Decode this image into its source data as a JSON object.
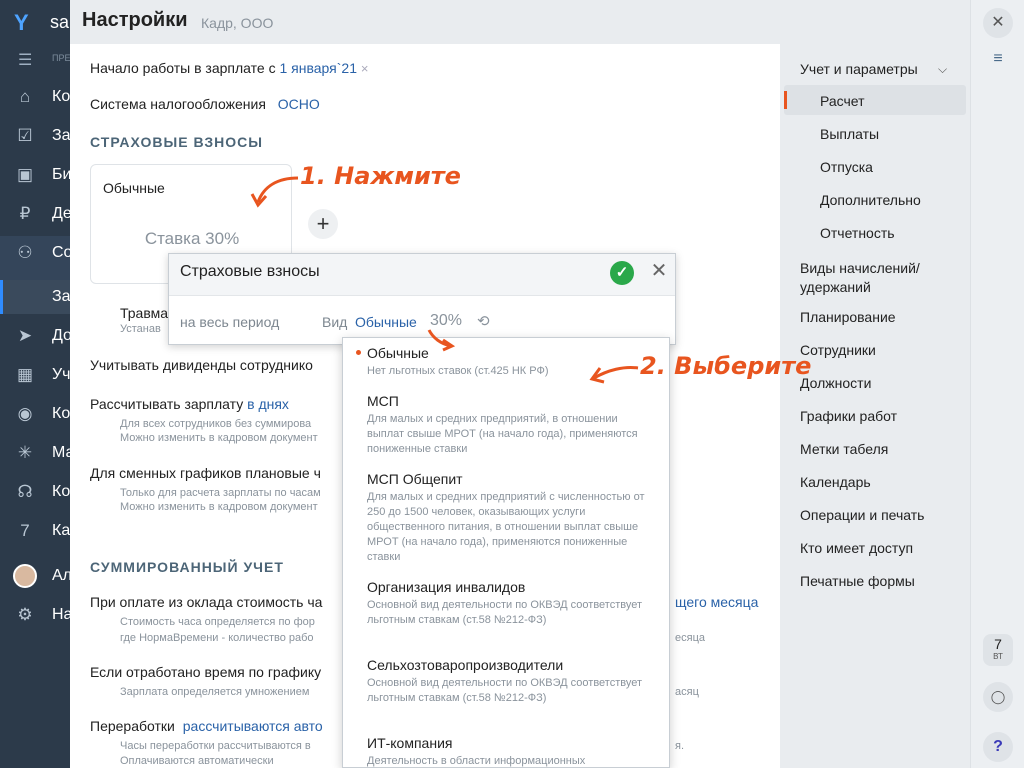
{
  "app": {
    "brand": "sa",
    "nav_hint": "ПРЕ"
  },
  "leftnav": {
    "items": [
      {
        "label": "Ко",
        "icon": "home-icon"
      },
      {
        "label": "За",
        "icon": "tasks-icon"
      },
      {
        "label": "Би",
        "icon": "briefcase-icon"
      },
      {
        "label": "Де",
        "icon": "money-icon"
      },
      {
        "label": "Со",
        "icon": "people-icon"
      },
      {
        "label": "За",
        "icon": "submenu-icon"
      },
      {
        "label": "До",
        "icon": "send-icon"
      },
      {
        "label": "Уч",
        "icon": "calculator-icon"
      },
      {
        "label": "Ко",
        "icon": "location-icon"
      },
      {
        "label": "Ма",
        "icon": "burst-icon"
      },
      {
        "label": "Ко",
        "icon": "headset-icon"
      },
      {
        "label": "Ка",
        "icon": "calendar-icon"
      },
      {
        "label": "Ал",
        "icon": "avatar"
      },
      {
        "label": "На",
        "icon": "gear-icon"
      }
    ]
  },
  "header": {
    "title": "Настройки",
    "subtitle": "Кадр, ООО"
  },
  "main": {
    "start_label": "Начало работы в зарплате с",
    "start_value": "1 января`21",
    "tax_label": "Система налогообложения",
    "tax_value": "ОСНО",
    "insurance_section": "СТРАХОВЫЕ ВЗНОСЫ",
    "card_title": "Обычные",
    "card_rate": "Ставка 30%",
    "plus": "+",
    "injury_label": "Травма",
    "injury_hint": "Устанав",
    "dividends_label": "Учитывать дивиденды сотруднико",
    "salary_label": "Рассчитывать зарплату",
    "salary_value": "в днях",
    "salary_hint1": "Для всех сотрудников без суммирова",
    "salary_hint2": "Можно изменить в кадровом документ",
    "shift_label": "Для сменных графиков плановые ч",
    "shift_hint1": "Только для расчета зарплаты по часам",
    "shift_hint2": "Можно изменить в кадровом документ",
    "summary_section": "СУММИРОВАННЫЙ УЧЕТ",
    "oklad_label": "При оплате из оклада стоимость ча",
    "oklad_value_tail": "щего месяца",
    "oklad_hint1": "Стоимость часа определяется по фор",
    "oklad_hint1_tail": "есяца",
    "oklad_hint2": "где НормаВремени - количество рабо",
    "worked_label": "Если отработано время по графику",
    "worked_hint": "Зарплата определяется умножением",
    "worked_hint_tail": "асяц",
    "overtime_label": "Переработки",
    "overtime_value": "рассчитываются авто",
    "overtime_hint1": "Часы переработки рассчитываются в",
    "overtime_hint1_tail": "я.",
    "overtime_hint2": "Оплачиваются автоматически"
  },
  "popup": {
    "title": "Страховые взносы",
    "period": "на весь период",
    "vid_label": "Вид",
    "vid_value": "Обычные",
    "percent": "30%"
  },
  "dropdown": {
    "options": [
      {
        "name": "Обычные",
        "desc": "Нет льготных ставок (ст.425 НК РФ)",
        "selected": true
      },
      {
        "name": "МСП",
        "desc": "Для малых и средних предприятий, в отношении выплат свыше МРОТ (на начало года), применяются пониженные ставки"
      },
      {
        "name": "МСП Общепит",
        "desc": "Для малых и средних предприятий с численностью от 250 до 1500 человек, оказывающих услуги общественного питания, в отношении выплат свыше МРОТ (на начало года), применяются пониженные ставки"
      },
      {
        "name": "Организация инвалидов",
        "desc": "Основной вид деятельности по ОКВЭД соответствует льготным ставкам (ст.58 №212-ФЗ)"
      },
      {
        "name": "Сельхозтоваропроизводители",
        "desc": "Основной вид деятельности по ОКВЭД соответствует льготным ставкам (ст.58 №212-ФЗ)"
      },
      {
        "name": "ИТ-компания",
        "desc": "Деятельность в области информационных"
      }
    ]
  },
  "rightnav": {
    "group": "Учет и параметры",
    "sub_items": [
      "Расчет",
      "Выплаты",
      "Отпуска",
      "Дополнительно",
      "Отчетность"
    ],
    "items": [
      "Виды начислений/ удержаний",
      "Планирование",
      "Сотрудники",
      "Должности",
      "Графики работ",
      "Метки табеля",
      "Календарь",
      "Операции и печать",
      "Кто имеет доступ",
      "Печатные формы"
    ]
  },
  "farright": {
    "day": "7",
    "weekday": "ВТ",
    "help": "?"
  },
  "annotations": {
    "step1": "1. Нажмите",
    "step2": "2. Выберите",
    "color": "#e8551f"
  }
}
